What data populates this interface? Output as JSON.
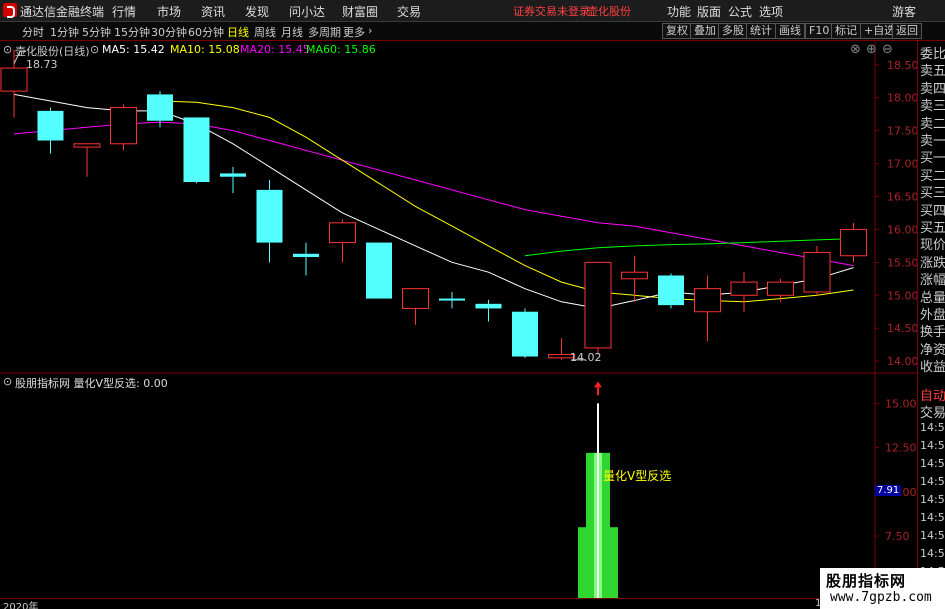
{
  "titlebar": {
    "app_title": "通达信金融终端",
    "menus": [
      "行情",
      "市场",
      "资讯",
      "发现",
      "问小达",
      "财富圈",
      "交易"
    ],
    "trade_status": "证券交易未登录",
    "stock_name": "壶化股份",
    "right_items": [
      "功能",
      "版面",
      "公式",
      "选项",
      "画线",
      "游客"
    ]
  },
  "toolbar": {
    "periods": [
      "分时",
      "1分钟",
      "5分钟",
      "15分钟",
      "30分钟",
      "60分钟",
      "日线",
      "周线",
      "月线",
      "多周期",
      "更多"
    ],
    "active_period": "日线",
    "buttons": [
      "复权",
      "叠加",
      "多股",
      "统计",
      "画线",
      "F10",
      "标记",
      "+自选",
      "返回"
    ]
  },
  "main_chart": {
    "stock_label": "壶化股份(日线)",
    "ma5": "MA5: 15.42",
    "ma10": "MA10: 15.08",
    "ma20": "MA20: 15.45",
    "ma60": "MA60: 15.86",
    "high_marker": "18.73",
    "low_marker": "14.02",
    "colors": {
      "up": "#ff3232",
      "down": "#54ffff",
      "ma5": "#ffffff",
      "ma10": "#ffff00",
      "ma20": "#ff00ff",
      "ma60": "#00ff00"
    }
  },
  "sub_chart": {
    "indicator_label": "股朋指标网 量化V型反选: 0.00",
    "signal_label": "量化V型反选",
    "cursor_value": "7.91"
  },
  "right_panel": {
    "items": [
      "委比",
      "卖五",
      "卖四",
      "卖三",
      "卖二",
      "卖一",
      "买一",
      "买二",
      "买三",
      "买四",
      "买五",
      "现价",
      "涨跌",
      "涨幅",
      "总量",
      "外盘",
      "换手",
      "净资",
      "收益"
    ],
    "auto_trade": [
      "自动",
      "交易"
    ],
    "times": [
      "14:55",
      "14:56",
      "14:56",
      "14:56",
      "14:56",
      "14:56",
      "14:56",
      "14:56",
      "14:56",
      "14:56"
    ]
  },
  "bottom": {
    "year": "2020年",
    "marker": "1"
  },
  "watermark": {
    "title": "股朋指标网",
    "url": "www.7gpzb.com"
  },
  "chart_data": [
    {
      "type": "candlestick",
      "title": "壶化股份(日线)",
      "ylim": [
        13.85,
        18.8
      ],
      "y_ticks": [
        14.0,
        14.5,
        15.0,
        15.5,
        16.0,
        16.5,
        17.0,
        17.5,
        18.0,
        18.5
      ],
      "candles": [
        {
          "o": 18.1,
          "h": 18.73,
          "l": 17.7,
          "c": 18.45
        },
        {
          "o": 17.8,
          "h": 17.85,
          "l": 17.15,
          "c": 17.35
        },
        {
          "o": 17.25,
          "h": 17.3,
          "l": 16.8,
          "c": 17.3
        },
        {
          "o": 17.3,
          "h": 17.9,
          "l": 17.2,
          "c": 17.85
        },
        {
          "o": 18.05,
          "h": 18.1,
          "l": 17.55,
          "c": 17.65
        },
        {
          "o": 17.7,
          "h": 17.7,
          "l": 16.7,
          "c": 16.72
        },
        {
          "o": 16.85,
          "h": 16.95,
          "l": 16.55,
          "c": 16.8
        },
        {
          "o": 16.6,
          "h": 16.75,
          "l": 15.5,
          "c": 15.8
        },
        {
          "o": 15.63,
          "h": 15.8,
          "l": 15.3,
          "c": 15.58
        },
        {
          "o": 15.8,
          "h": 16.15,
          "l": 15.5,
          "c": 16.1
        },
        {
          "o": 15.8,
          "h": 15.8,
          "l": 14.95,
          "c": 14.95
        },
        {
          "o": 14.8,
          "h": 15.1,
          "l": 14.55,
          "c": 15.1
        },
        {
          "o": 14.95,
          "h": 15.05,
          "l": 14.8,
          "c": 14.93
        },
        {
          "o": 14.87,
          "h": 14.93,
          "l": 14.6,
          "c": 14.8
        },
        {
          "o": 14.75,
          "h": 14.8,
          "l": 14.05,
          "c": 14.07
        },
        {
          "o": 14.05,
          "h": 14.35,
          "l": 14.02,
          "c": 14.1
        },
        {
          "o": 14.2,
          "h": 15.5,
          "l": 14.1,
          "c": 15.5
        },
        {
          "o": 15.25,
          "h": 15.6,
          "l": 14.9,
          "c": 15.35
        },
        {
          "o": 15.3,
          "h": 15.33,
          "l": 14.8,
          "c": 14.85
        },
        {
          "o": 14.75,
          "h": 15.3,
          "l": 14.3,
          "c": 15.1
        },
        {
          "o": 15.0,
          "h": 15.35,
          "l": 14.75,
          "c": 15.2
        },
        {
          "o": 15.0,
          "h": 15.25,
          "l": 14.9,
          "c": 15.2
        },
        {
          "o": 15.05,
          "h": 15.75,
          "l": 15.0,
          "c": 15.65
        },
        {
          "o": 15.6,
          "h": 16.1,
          "l": 15.5,
          "c": 16.0
        }
      ],
      "ma5": [
        18.05,
        17.95,
        17.85,
        17.8,
        17.8,
        17.6,
        17.3,
        16.95,
        16.6,
        16.25,
        16.0,
        15.75,
        15.5,
        15.35,
        15.1,
        14.9,
        14.8,
        14.92,
        15.05,
        15.0,
        15.05,
        15.15,
        15.25,
        15.42
      ],
      "ma10": [
        null,
        null,
        null,
        null,
        17.95,
        17.93,
        17.85,
        17.7,
        17.4,
        17.05,
        16.7,
        16.35,
        16.05,
        15.75,
        15.45,
        15.2,
        15.05,
        15.0,
        14.95,
        14.92,
        14.9,
        14.95,
        15.0,
        15.08
      ],
      "ma20": [
        17.45,
        17.5,
        17.55,
        17.6,
        17.63,
        17.6,
        17.5,
        17.35,
        17.2,
        17.05,
        16.9,
        16.75,
        16.6,
        16.45,
        16.3,
        16.2,
        16.1,
        16.05,
        15.95,
        15.85,
        15.75,
        15.65,
        15.55,
        15.45
      ],
      "ma60": [
        null,
        null,
        null,
        null,
        null,
        null,
        null,
        null,
        null,
        null,
        null,
        null,
        null,
        null,
        15.6,
        15.67,
        15.72,
        15.75,
        15.77,
        15.78,
        15.8,
        15.82,
        15.84,
        15.86
      ]
    },
    {
      "type": "bar",
      "title": "量化V型反选",
      "ylim": [
        4.0,
        16.6
      ],
      "y_ticks": [
        5.0,
        7.5,
        10.0,
        12.5,
        15.0
      ],
      "bars": [
        {
          "index": 16,
          "top": 12.2,
          "width": "wide"
        },
        {
          "index": 16,
          "top": 8.0,
          "width": "outer"
        }
      ],
      "signal_peak": 15.0,
      "signal_arrow": "up"
    }
  ]
}
